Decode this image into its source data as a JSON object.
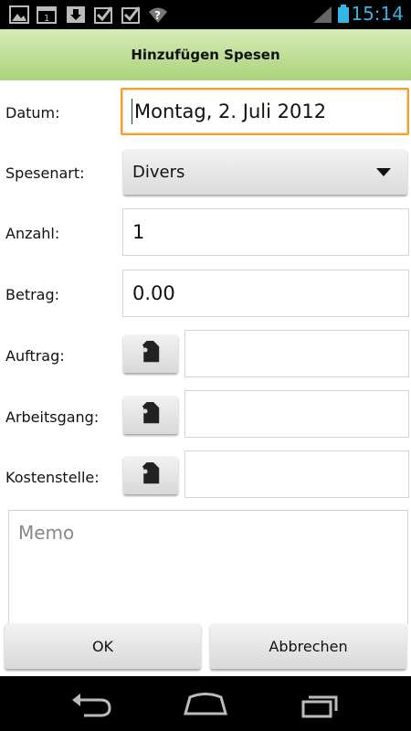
{
  "status_bar": {
    "time": "15:14",
    "icons": [
      "image-notification-icon",
      "calendar-notification-icon",
      "download-icon",
      "check-icon",
      "check-icon",
      "wifi-question-icon",
      "signal-icon",
      "battery-icon"
    ],
    "accent": "#33b5e5"
  },
  "title": "Hinzufügen Spesen",
  "form": {
    "datum": {
      "label": "Datum:",
      "value": "Montag, 2. Juli 2012"
    },
    "spesenart": {
      "label": "Spesenart:",
      "value": "Divers"
    },
    "anzahl": {
      "label": "Anzahl:",
      "value": "1"
    },
    "betrag": {
      "label": "Betrag:",
      "value": "0.00"
    },
    "auftrag": {
      "label": "Auftrag:",
      "value": ""
    },
    "arbeitsgang": {
      "label": "Arbeitsgang:",
      "value": ""
    },
    "kostenstelle": {
      "label": "Kostenstelle:",
      "value": ""
    },
    "memo": {
      "placeholder": "Memo"
    }
  },
  "buttons": {
    "ok": "OK",
    "cancel": "Abbrechen"
  },
  "colors": {
    "focus": "#f0a030",
    "title_top": "#d8ebb9",
    "title_bottom": "#a9d37a"
  }
}
